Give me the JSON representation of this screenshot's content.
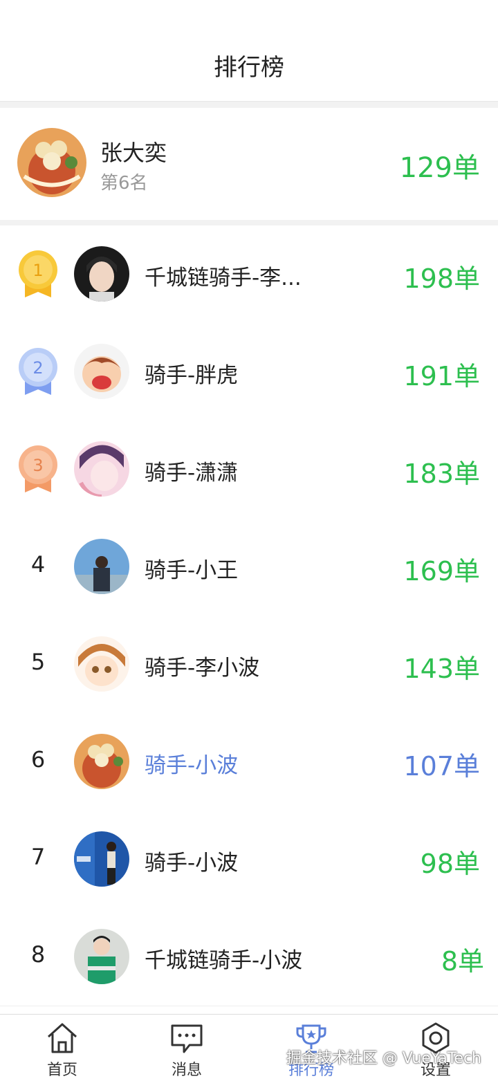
{
  "header": {
    "title": "排行榜"
  },
  "me": {
    "name": "张大奕",
    "rank_text": "第6名",
    "count": "129单"
  },
  "list": [
    {
      "rank": "1",
      "name": "千城链骑手-李...",
      "count": "198单",
      "medal": "gold"
    },
    {
      "rank": "2",
      "name": "骑手-胖虎",
      "count": "191单",
      "medal": "silver"
    },
    {
      "rank": "3",
      "name": "骑手-潇潇",
      "count": "183单",
      "medal": "bronze"
    },
    {
      "rank": "4",
      "name": "骑手-小王",
      "count": "169单"
    },
    {
      "rank": "5",
      "name": "骑手-李小波",
      "count": "143单"
    },
    {
      "rank": "6",
      "name": "骑手-小波",
      "count": "107单",
      "highlight": true
    },
    {
      "rank": "7",
      "name": "骑手-小波",
      "count": "98单"
    },
    {
      "rank": "8",
      "name": "千城链骑手-小波",
      "count": "8单"
    }
  ],
  "tabs": [
    {
      "label": "首页",
      "icon": "home-icon"
    },
    {
      "label": "消息",
      "icon": "message-icon"
    },
    {
      "label": "排行榜",
      "icon": "trophy-icon",
      "active": true
    },
    {
      "label": "设置",
      "icon": "settings-icon"
    }
  ],
  "watermark": "掘金技术社区 @ VueYaTech",
  "colors": {
    "count_green": "#2dbf4f",
    "accent_blue": "#5a7fd9"
  }
}
